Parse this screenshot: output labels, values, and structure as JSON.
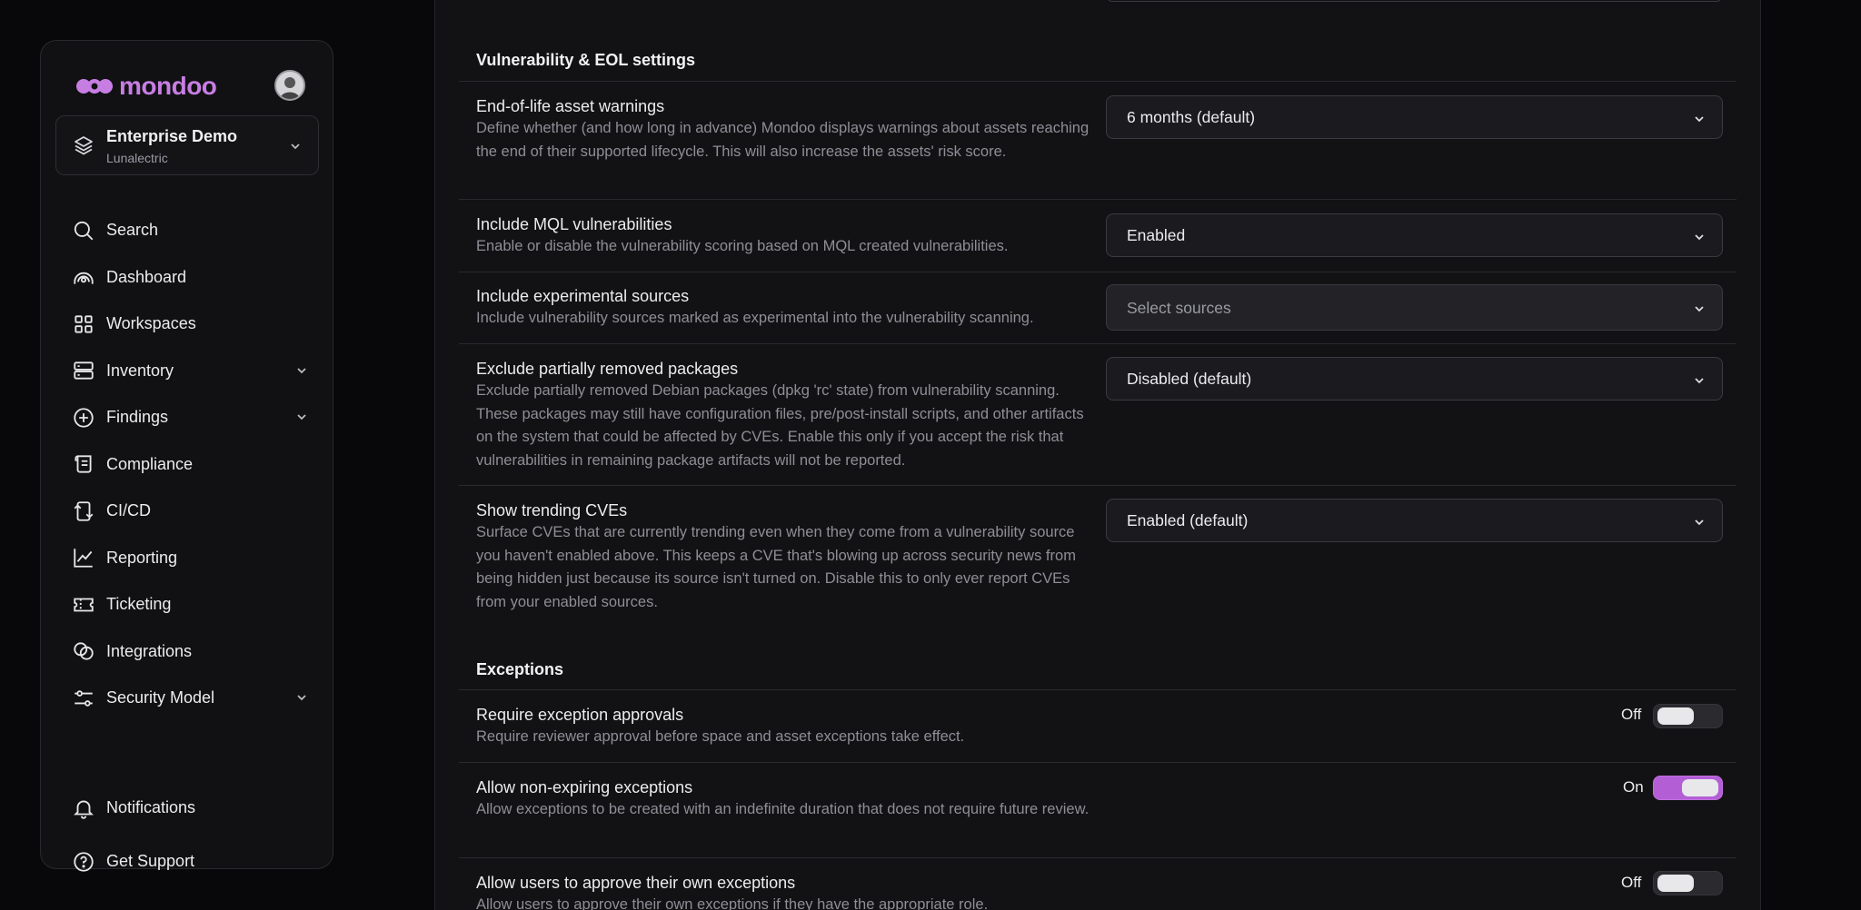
{
  "brand": {
    "name": "mondoo",
    "accent": "#c77ee3",
    "toggle_on": "#b45ed6"
  },
  "org": {
    "name": "Enterprise Demo",
    "sub": "Lunalectric"
  },
  "nav": {
    "items": [
      {
        "label": "Search",
        "icon": "search-icon"
      },
      {
        "label": "Dashboard",
        "icon": "dashboard-icon"
      },
      {
        "label": "Workspaces",
        "icon": "grid-icon"
      },
      {
        "label": "Inventory",
        "icon": "server-icon",
        "expandable": true
      },
      {
        "label": "Findings",
        "icon": "plus-circle-icon",
        "expandable": true
      },
      {
        "label": "Compliance",
        "icon": "scroll-icon"
      },
      {
        "label": "CI/CD",
        "icon": "cicd-icon"
      },
      {
        "label": "Reporting",
        "icon": "chart-line-icon"
      },
      {
        "label": "Ticketing",
        "icon": "ticket-icon"
      },
      {
        "label": "Integrations",
        "icon": "integrations-icon"
      },
      {
        "label": "Security Model",
        "icon": "sliders-icon",
        "expandable": true
      }
    ],
    "bottom": [
      {
        "label": "Notifications",
        "icon": "bell-icon"
      },
      {
        "label": "Get Support",
        "icon": "help-circle-icon"
      }
    ]
  },
  "vuln": {
    "title": "Vulnerability & EOL settings",
    "rows": [
      {
        "title": "End-of-life asset warnings",
        "desc": "Define whether (and how long in advance) Mondoo displays warnings about assets reaching the end of their supported lifecycle. This will also increase the assets' risk score.",
        "value": "6 months (default)"
      },
      {
        "title": "Include MQL vulnerabilities",
        "desc": "Enable or disable the vulnerability scoring based on MQL created vulnerabilities.",
        "value": "Enabled"
      },
      {
        "title": "Include experimental sources",
        "desc": "Include vulnerability sources marked as experimental into the vulnerability scanning.",
        "placeholder": "Select sources"
      },
      {
        "title": "Exclude partially removed packages",
        "desc": "Exclude partially removed Debian packages (dpkg 'rc' state) from vulnerability scanning. These packages may still have configuration files, pre/post-install scripts, and other artifacts on the system that could be affected by CVEs. Enable this only if you accept the risk that vulnerabilities in remaining package artifacts will not be reported.",
        "value": "Disabled (default)"
      },
      {
        "title": "Show trending CVEs",
        "desc": "Surface CVEs that are currently trending even when they come from a vulnerability source you haven't enabled above. This keeps a CVE that's blowing up across security news from being hidden just because its source isn't turned on. Disable this to only ever report CVEs from your enabled sources.",
        "value": "Enabled (default)"
      }
    ]
  },
  "exceptions": {
    "title": "Exceptions",
    "rows": [
      {
        "title": "Require exception approvals",
        "desc": "Require reviewer approval before space and asset exceptions take effect.",
        "state": "Off"
      },
      {
        "title": "Allow non-expiring exceptions",
        "desc": "Allow exceptions to be created with an indefinite duration that does not require future review.",
        "state": "On"
      },
      {
        "title": "Allow users to approve their own exceptions",
        "desc": "Allow users to approve their own exceptions if they have the appropriate role.",
        "state": "Off"
      }
    ]
  }
}
